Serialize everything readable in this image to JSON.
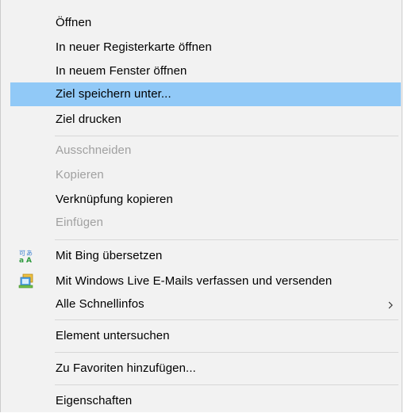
{
  "menu": {
    "items": [
      {
        "label": "Öffnen",
        "enabled": true
      },
      {
        "label": "In neuer Registerkarte öffnen",
        "enabled": true
      },
      {
        "label": "In neuem Fenster öffnen",
        "enabled": true
      },
      {
        "label": "Ziel speichern unter...",
        "enabled": true,
        "highlighted": true
      },
      {
        "label": "Ziel drucken",
        "enabled": true
      },
      {
        "label": "Ausschneiden",
        "enabled": false
      },
      {
        "label": "Kopieren",
        "enabled": false
      },
      {
        "label": "Verknüpfung kopieren",
        "enabled": true
      },
      {
        "label": "Einfügen",
        "enabled": false
      },
      {
        "label": "Mit Bing übersetzen",
        "enabled": true,
        "icon": "translate-icon"
      },
      {
        "label": "Mit Windows Live E-Mails verfassen und versenden",
        "enabled": true,
        "icon": "windows-live-mail-icon"
      },
      {
        "label": "Alle Schnellinfos",
        "enabled": true,
        "submenu": true
      },
      {
        "label": "Element untersuchen",
        "enabled": true
      },
      {
        "label": "Zu Favoriten hinzufügen...",
        "enabled": true
      },
      {
        "label": "Eigenschaften",
        "enabled": true
      }
    ],
    "colors": {
      "background": "#f2f2f2",
      "highlight": "#91c9f7",
      "disabled_text": "#a0a0a0",
      "separator": "#d7d7d7"
    }
  }
}
